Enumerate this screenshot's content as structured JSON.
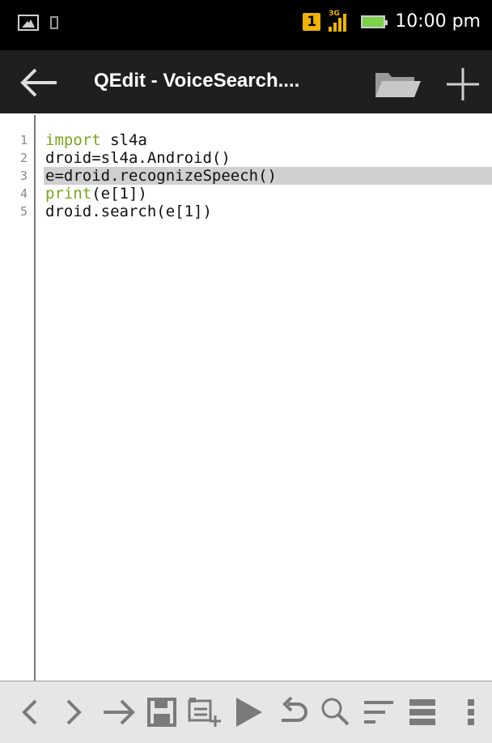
{
  "status_bar": {
    "sim_slot": "1",
    "network_type": "3G",
    "time": "10:00 pm",
    "icons": [
      "gallery-icon",
      "notification-icon",
      "sim-icon",
      "signal-icon",
      "battery-icon"
    ]
  },
  "action_bar": {
    "title": "QEdit - VoiceSearch....",
    "icons": [
      "back-arrow-icon",
      "folder-icon",
      "plus-icon"
    ]
  },
  "editor": {
    "line_numbers": [
      "1",
      "2",
      "3",
      "4",
      "5"
    ],
    "highlighted_line": 3,
    "lines": [
      {
        "keyword": "import",
        "rest": " sl4a"
      },
      {
        "keyword": "",
        "rest": "droid=sl4a.Android()"
      },
      {
        "keyword": "",
        "rest": "e=droid.recognizeSpeech()"
      },
      {
        "keyword": "print",
        "rest": "(e[1])"
      },
      {
        "keyword": "",
        "rest": "droid.search(e[1])"
      }
    ],
    "keyword_color": "#7aa51c"
  },
  "toolbar": {
    "icons": [
      "chevron-left-icon",
      "chevron-right-icon",
      "arrow-right-icon",
      "save-icon",
      "insert-icon",
      "run-icon",
      "undo-icon",
      "search-icon",
      "wrap-icon",
      "list-icon",
      "overflow-menu-icon"
    ]
  }
}
